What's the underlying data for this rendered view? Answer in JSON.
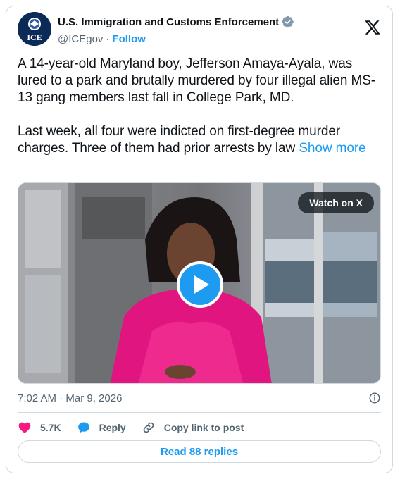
{
  "account": {
    "name": "U.S. Immigration and Customs Enforcement",
    "handle": "@ICEgov",
    "separator": "·",
    "follow_label": "Follow",
    "avatar_text": "ICE"
  },
  "tweet": {
    "paragraph1": "A 14-year-old Maryland boy, Jefferson Amaya-Ayala, was lured to a park and brutally murdered by four illegal alien MS-13 gang members last fall in College Park, MD.",
    "paragraph2": "Last week, all four were indicted on first-degree murder charges. Three of them had prior arrests by law ",
    "show_more": "Show more"
  },
  "media": {
    "watch_label": "Watch on X"
  },
  "meta": {
    "timestamp": "7:02 AM · Mar 9, 2026"
  },
  "actions": {
    "likes": "5.7K",
    "reply_label": "Reply",
    "copy_label": "Copy link to post"
  },
  "replies": {
    "label": "Read 88 replies"
  },
  "colors": {
    "accent": "#1d9bf0",
    "like": "#f91880",
    "text": "#0f1419",
    "secondary": "#536471",
    "border": "#cfd9de"
  }
}
